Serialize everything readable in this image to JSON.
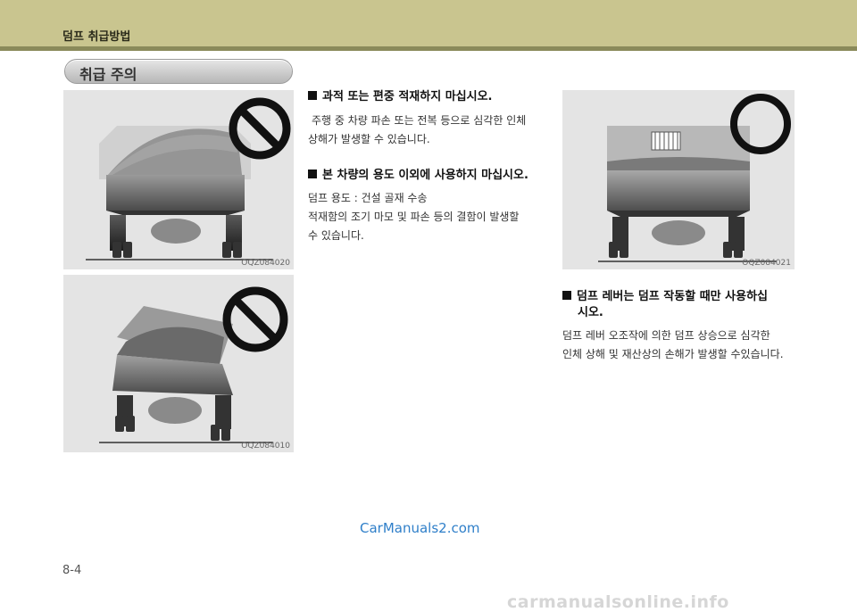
{
  "header": {
    "title": "덤프 취급방법"
  },
  "section_pill": "취급 주의",
  "figures": [
    {
      "code": "OQZ084020",
      "icon": "prohibition-icon"
    },
    {
      "code": "OQZ084010",
      "icon": "prohibition-icon"
    },
    {
      "code": "OQZ084021",
      "icon": "ok-circle-icon"
    }
  ],
  "notes": [
    {
      "title": "과적 또는 편중 적재하지 마십시오.",
      "lines": [
        "주행 중 차량 파손 또는 전복 등으로 심각한 인체",
        "상해가 발생할 수 있습니다."
      ]
    },
    {
      "title": "본 차량의 용도 이외에 사용하지 마십시오.",
      "lines": [
        "덤프 용도 : 건설 골재 수송",
        "적재함의 조기 마모 및 파손 등의 결함이 발생할",
        "수 있습니다."
      ]
    },
    {
      "title_lines": [
        "덤프 레버는 덤프 작동할 때만 사용하십",
        "시오."
      ],
      "lines": [
        "덤프 레버 오조작에 의한 덤프 상승으로 심각한",
        "인체 상해 및 재산상의 손해가 발생할 수있습니다."
      ]
    }
  ],
  "watermark": "CarManuals2.com",
  "page_number": "8-4",
  "footer_watermark": "carmanualsonline.info"
}
